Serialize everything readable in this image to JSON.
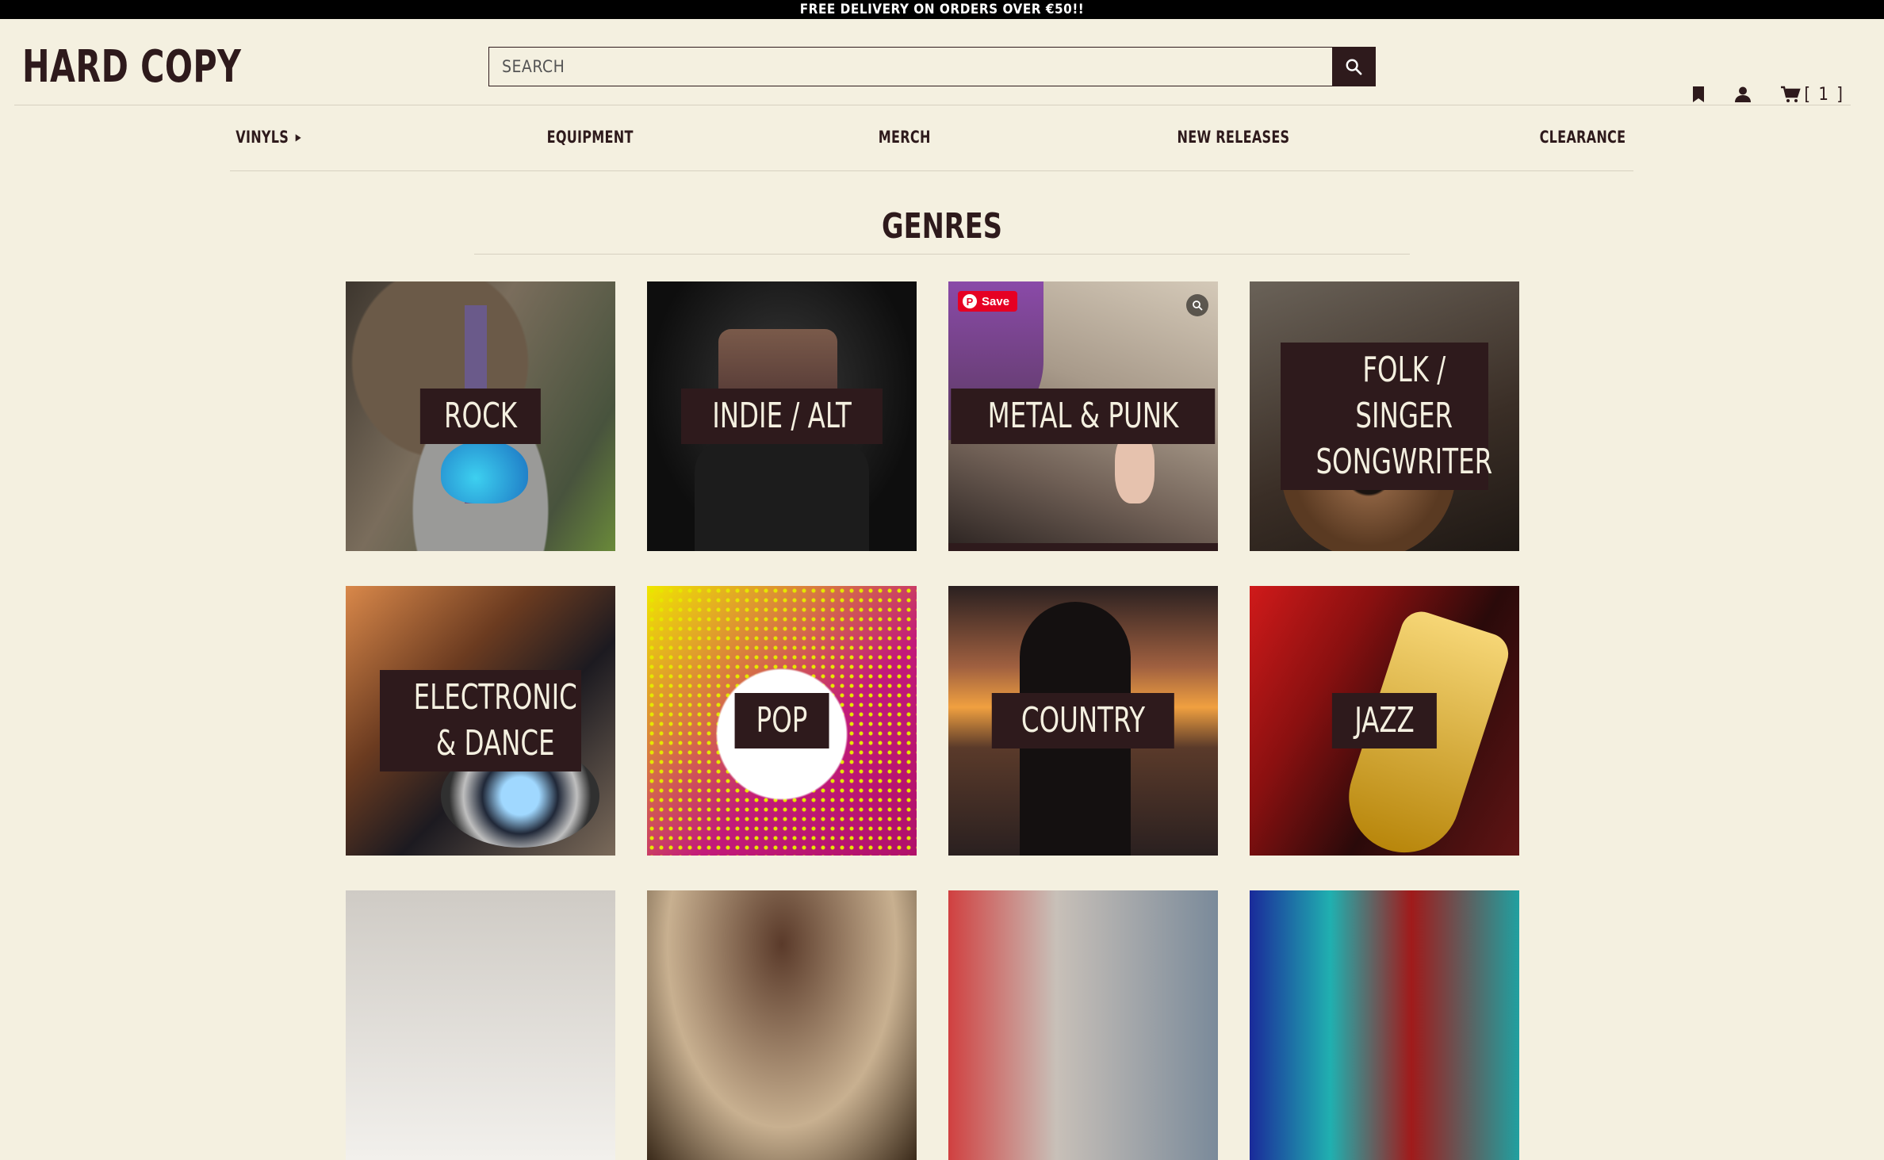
{
  "announcement": "FREE DELIVERY ON ORDERS OVER €50!!",
  "header": {
    "logo": "HARD COPY",
    "search_placeholder": "SEARCH",
    "cart_count": "[ 1 ]"
  },
  "nav": {
    "items": [
      {
        "label": "VINYLS"
      },
      {
        "label": "EQUIPMENT"
      },
      {
        "label": "MERCH"
      },
      {
        "label": "NEW RELEASES"
      },
      {
        "label": "CLEARANCE"
      }
    ]
  },
  "genres": {
    "title": "GENRES",
    "tiles": [
      {
        "label": "ROCK"
      },
      {
        "label": "INDIE / ALT"
      },
      {
        "label": "METAL & PUNK"
      },
      {
        "label": "FOLK / SINGER SONGWRITER"
      },
      {
        "label": "ELECTRONIC & DANCE"
      },
      {
        "label": "POP"
      },
      {
        "label": "COUNTRY"
      },
      {
        "label": "JAZZ"
      }
    ]
  },
  "pin_save_label": "Save",
  "colors": {
    "background": "#f4f0e0",
    "brand_dark": "#2e1a1c",
    "topbar": "#000000",
    "pinterest": "#e60023"
  },
  "icons": [
    "search-icon",
    "bookmark-icon",
    "account-icon",
    "cart-icon",
    "caret-right-icon",
    "pinterest-icon",
    "visual-search-icon"
  ]
}
